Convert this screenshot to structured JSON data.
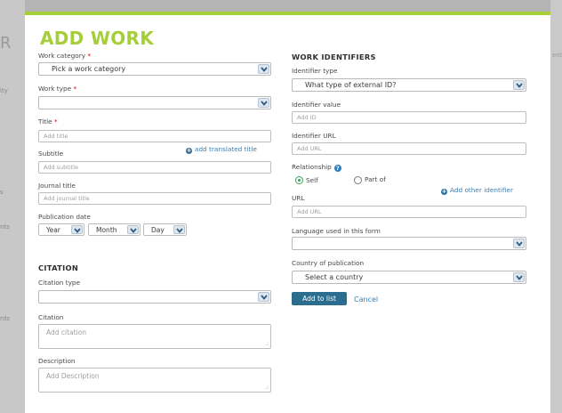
{
  "modal_title": "ADD WORK",
  "left": {
    "work_category": {
      "label": "Work category",
      "required_mark": "*",
      "value": "Pick a work category"
    },
    "work_type": {
      "label": "Work type",
      "required_mark": "*",
      "value": ""
    },
    "title": {
      "label": "Title",
      "required_mark": "*",
      "placeholder": "Add title"
    },
    "add_translated_title": "add translated title",
    "subtitle": {
      "label": "Subtitle",
      "placeholder": "Add subtitle"
    },
    "journal_title": {
      "label": "Journal title",
      "placeholder": "Add journal title"
    },
    "publication_date": {
      "label": "Publication date",
      "year": "Year",
      "month": "Month",
      "day": "Day"
    },
    "citation_heading": "CITATION",
    "citation_type": {
      "label": "Citation type",
      "value": ""
    },
    "citation": {
      "label": "Citation",
      "placeholder": "Add citation"
    },
    "description": {
      "label": "Description",
      "placeholder": "Add Description"
    }
  },
  "right": {
    "heading": "WORK IDENTIFIERS",
    "identifier_type": {
      "label": "Identifier type",
      "value": "What type of external ID?"
    },
    "identifier_value": {
      "label": "Identifier value",
      "placeholder": "Add ID"
    },
    "identifier_url": {
      "label": "Identifier URL",
      "placeholder": "Add URL"
    },
    "relationship": {
      "label": "Relationship",
      "options": [
        "Self",
        "Part of"
      ],
      "selected": "Self"
    },
    "add_other_identifier": "Add other identifier",
    "url": {
      "label": "URL",
      "placeholder": "Add URL"
    },
    "language": {
      "label": "Language used in this form",
      "value": ""
    },
    "country": {
      "label": "Country of publication",
      "value": "Select a country"
    },
    "add_to_list_button": "Add to list",
    "cancel_link": "Cancel"
  },
  "background_fragments": [
    "R",
    "ity",
    "s",
    "nts",
    "rds",
    "ent"
  ],
  "colors": {
    "accent": "#a6ce39",
    "link": "#3a7fb3",
    "button": "#2b6d8f",
    "required": "#cc0000",
    "selected_radio": "#3aa35a"
  },
  "icons": [
    "chevron-down-icon",
    "plus-circle-icon",
    "help-icon",
    "resize-grip-icon"
  ]
}
